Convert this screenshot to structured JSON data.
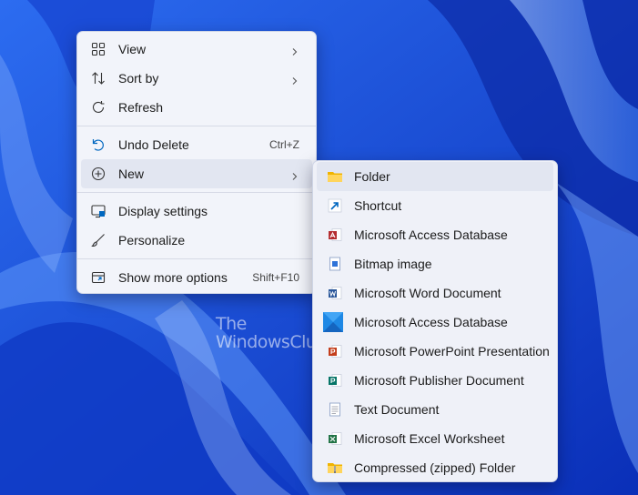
{
  "watermark": {
    "line1": "The",
    "line2": "WindowsClub"
  },
  "context_menu": {
    "items": [
      {
        "label": "View",
        "icon": "grid-icon",
        "submenu": true
      },
      {
        "label": "Sort by",
        "icon": "sort-icon",
        "submenu": true
      },
      {
        "label": "Refresh",
        "icon": "refresh-icon"
      },
      {
        "label": "Undo Delete",
        "icon": "undo-icon",
        "shortcut": "Ctrl+Z"
      },
      {
        "label": "New",
        "icon": "plus-circle-icon",
        "submenu": true,
        "highlighted": true
      },
      {
        "label": "Display settings",
        "icon": "display-icon"
      },
      {
        "label": "Personalize",
        "icon": "brush-icon"
      },
      {
        "label": "Show more options",
        "icon": "more-options-icon",
        "shortcut": "Shift+F10"
      }
    ]
  },
  "new_submenu": {
    "items": [
      {
        "label": "Folder",
        "icon": "folder-icon",
        "highlighted": true
      },
      {
        "label": "Shortcut",
        "icon": "shortcut-icon"
      },
      {
        "label": "Microsoft Access Database",
        "icon": "access-icon"
      },
      {
        "label": "Bitmap image",
        "icon": "bitmap-icon"
      },
      {
        "label": "Microsoft Word Document",
        "icon": "word-icon"
      },
      {
        "label": "Microsoft Access Database",
        "icon": "access-blue-icon"
      },
      {
        "label": "Microsoft PowerPoint Presentation",
        "icon": "powerpoint-icon"
      },
      {
        "label": "Microsoft Publisher Document",
        "icon": "publisher-icon"
      },
      {
        "label": "Text Document",
        "icon": "text-document-icon"
      },
      {
        "label": "Microsoft Excel Worksheet",
        "icon": "excel-icon"
      },
      {
        "label": "Compressed (zipped) Folder",
        "icon": "zip-folder-icon"
      }
    ]
  },
  "colors": {
    "accent": "#0067c0",
    "menu_bg": "#f2f4fa",
    "highlight": "#e2e6f1",
    "wallpaper": "#1a4fd6"
  }
}
